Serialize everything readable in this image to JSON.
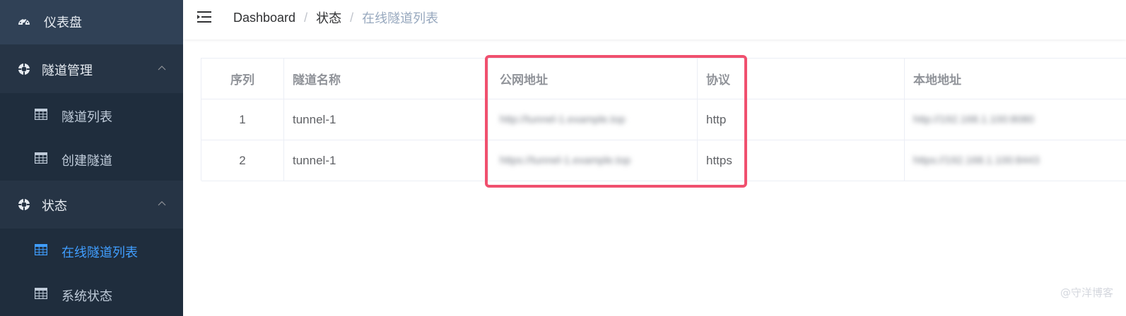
{
  "sidebar": {
    "items": [
      {
        "label": "仪表盘",
        "icon": "dashboard-icon"
      },
      {
        "label": "隧道管理",
        "icon": "ring-icon"
      },
      {
        "label": "隧道列表",
        "icon": "table-icon"
      },
      {
        "label": "创建隧道",
        "icon": "table-icon"
      },
      {
        "label": "状态",
        "icon": "ring-icon"
      },
      {
        "label": "在线隧道列表",
        "icon": "table-icon"
      },
      {
        "label": "系统状态",
        "icon": "table-icon"
      }
    ]
  },
  "header": {
    "breadcrumb": [
      "Dashboard",
      "状态",
      "在线隧道列表"
    ],
    "separator": "/"
  },
  "table": {
    "columns": [
      "序列",
      "隧道名称",
      "公网地址",
      "协议",
      "",
      "本地地址"
    ],
    "rows": [
      {
        "index": "1",
        "name": "tunnel-1",
        "public_addr": "http://tunnel-1.example.top",
        "protocol": "http",
        "local_addr": "http://192.168.1.100:8080"
      },
      {
        "index": "2",
        "name": "tunnel-1",
        "public_addr": "https://tunnel-1.example.top",
        "protocol": "https",
        "local_addr": "https://192.168.1.100:8443"
      }
    ]
  },
  "colors": {
    "sidebar_bg": "#304156",
    "active_text": "#409eff",
    "highlight": "#f0506e"
  },
  "watermark": "@守洋博客"
}
